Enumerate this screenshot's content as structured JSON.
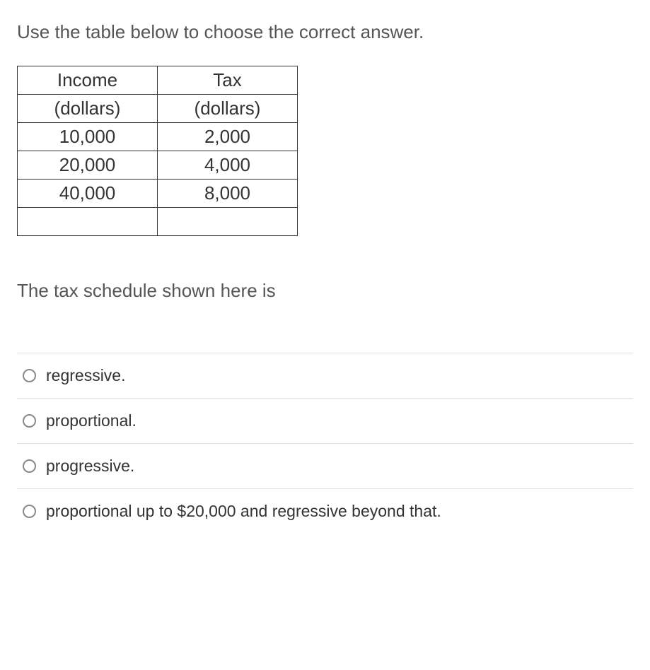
{
  "instruction": "Use the table below to choose the correct answer.",
  "table": {
    "header1": {
      "c0": "Income",
      "c1": "Tax"
    },
    "header2": {
      "c0": "(dollars)",
      "c1": "(dollars)"
    },
    "rows": [
      {
        "c0": "10,000",
        "c1": "2,000"
      },
      {
        "c0": "20,000",
        "c1": "4,000"
      },
      {
        "c0": "40,000",
        "c1": "8,000"
      },
      {
        "c0": "",
        "c1": ""
      }
    ]
  },
  "followup": "The tax schedule shown here is",
  "choices": [
    {
      "label": "regressive."
    },
    {
      "label": "proportional."
    },
    {
      "label": "progressive."
    },
    {
      "label": "proportional up to $20,000 and regressive beyond that."
    }
  ],
  "chart_data": {
    "type": "table",
    "columns": [
      "Income (dollars)",
      "Tax (dollars)"
    ],
    "rows": [
      [
        10000,
        2000
      ],
      [
        20000,
        4000
      ],
      [
        40000,
        8000
      ]
    ]
  }
}
